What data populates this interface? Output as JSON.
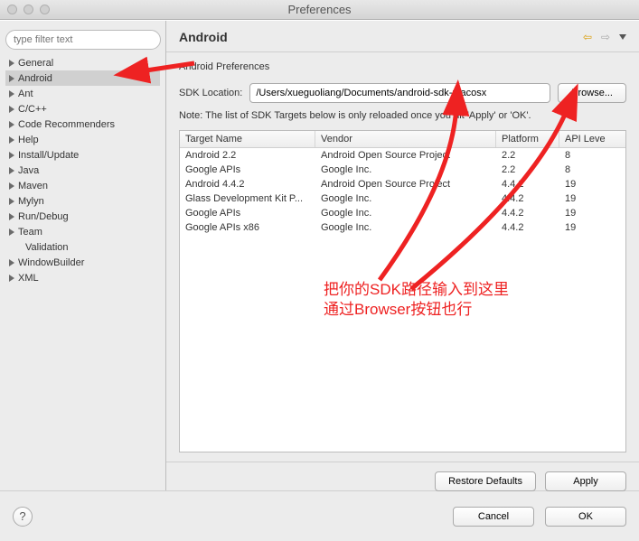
{
  "window": {
    "title": "Preferences"
  },
  "sidebar": {
    "filter_placeholder": "type filter text",
    "items": [
      {
        "label": "General",
        "sel": false,
        "child": false
      },
      {
        "label": "Android",
        "sel": true,
        "child": false
      },
      {
        "label": "Ant",
        "sel": false,
        "child": false
      },
      {
        "label": "C/C++",
        "sel": false,
        "child": false
      },
      {
        "label": "Code Recommenders",
        "sel": false,
        "child": false
      },
      {
        "label": "Help",
        "sel": false,
        "child": false
      },
      {
        "label": "Install/Update",
        "sel": false,
        "child": false
      },
      {
        "label": "Java",
        "sel": false,
        "child": false
      },
      {
        "label": "Maven",
        "sel": false,
        "child": false
      },
      {
        "label": "Mylyn",
        "sel": false,
        "child": false
      },
      {
        "label": "Run/Debug",
        "sel": false,
        "child": false
      },
      {
        "label": "Team",
        "sel": false,
        "child": false
      },
      {
        "label": "Validation",
        "sel": false,
        "child": true
      },
      {
        "label": "WindowBuilder",
        "sel": false,
        "child": false
      },
      {
        "label": "XML",
        "sel": false,
        "child": false
      }
    ]
  },
  "page": {
    "title": "Android",
    "subtitle": "Android Preferences",
    "sdk_label": "SDK Location:",
    "sdk_value": "/Users/xueguoliang/Documents/android-sdk-macosx",
    "browse_label": "Browse...",
    "note": "Note: The list of SDK Targets below is only reloaded once you hit 'Apply' or 'OK'.",
    "columns": [
      "Target Name",
      "Vendor",
      "Platform",
      "API Leve"
    ],
    "rows": [
      {
        "name": "Android 2.2",
        "vendor": "Android Open Source Project",
        "platform": "2.2",
        "api": "8"
      },
      {
        "name": "Google APIs",
        "vendor": "Google Inc.",
        "platform": "2.2",
        "api": "8"
      },
      {
        "name": "Android 4.4.2",
        "vendor": "Android Open Source Project",
        "platform": "4.4.2",
        "api": "19"
      },
      {
        "name": "Glass Development Kit P...",
        "vendor": "Google Inc.",
        "platform": "4.4.2",
        "api": "19"
      },
      {
        "name": "Google APIs",
        "vendor": "Google Inc.",
        "platform": "4.4.2",
        "api": "19"
      },
      {
        "name": "Google APIs x86",
        "vendor": "Google Inc.",
        "platform": "4.4.2",
        "api": "19"
      }
    ],
    "restore_label": "Restore Defaults",
    "apply_label": "Apply"
  },
  "footer": {
    "cancel_label": "Cancel",
    "ok_label": "OK"
  },
  "annotation": {
    "line1": "把你的SDK路径输入到这里",
    "line2": "通过Browser按钮也行"
  }
}
